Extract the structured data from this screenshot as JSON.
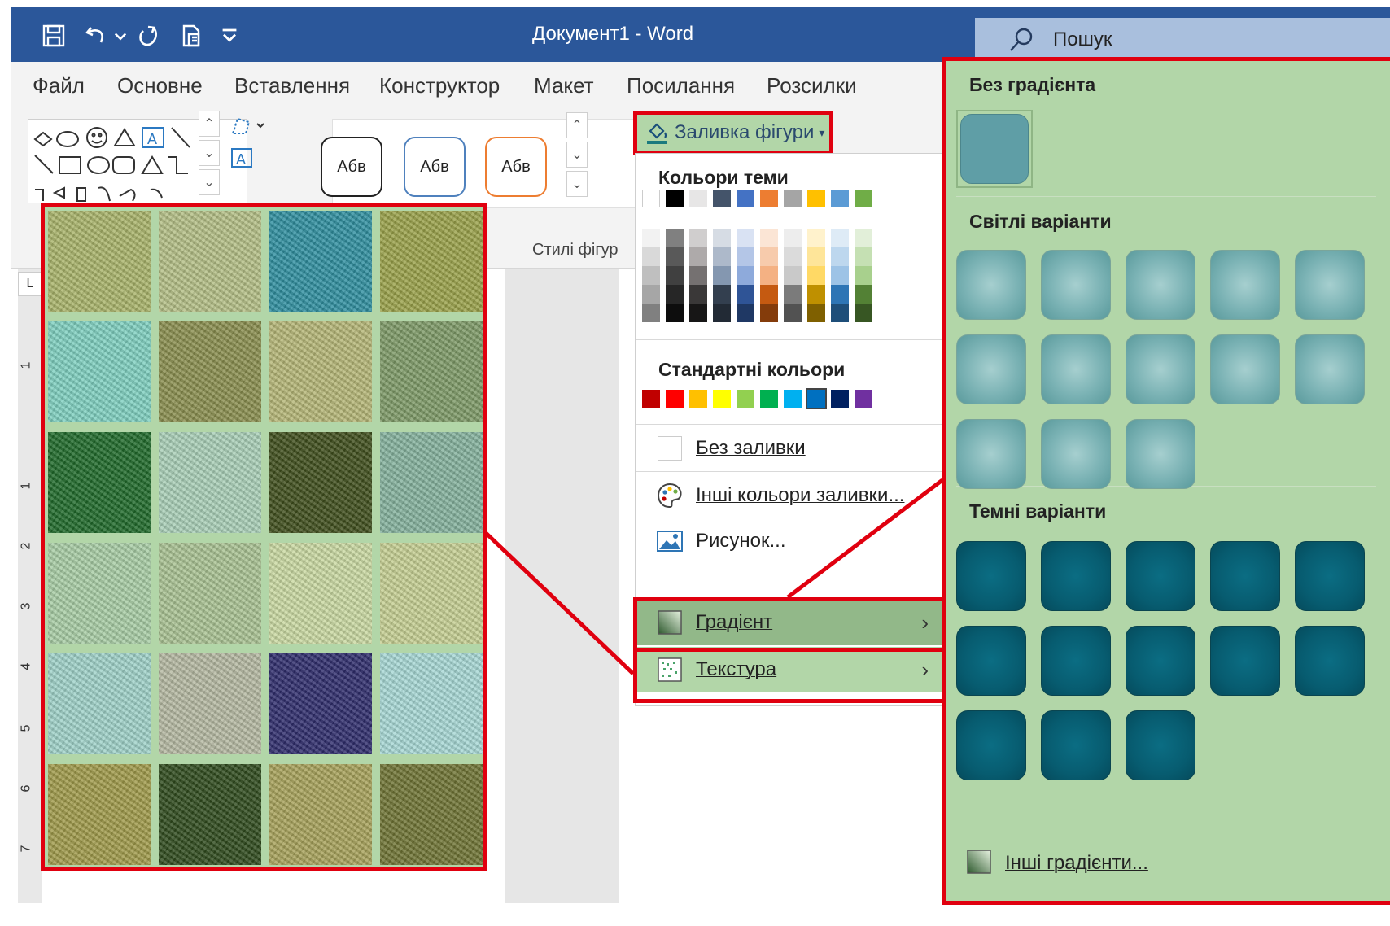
{
  "titlebar": {
    "title": "Документ1  -  Word",
    "search_placeholder": "Пошук",
    "bg_color": "#2b579a",
    "qat_icons": [
      "save-icon",
      "undo-icon",
      "redo-icon",
      "touch-mode-icon",
      "customize-qat-icon"
    ]
  },
  "menu": {
    "items": [
      "Файл",
      "Основне",
      "Вставлення",
      "Конструктор",
      "Макет",
      "Посилання",
      "Розсилки"
    ]
  },
  "ribbon": {
    "shape_style_label": "Абв",
    "styles_group_label": "Стилі фігур",
    "fill_button_label": "Заливка фігури"
  },
  "ruler": {
    "numbers": [
      "1",
      "1",
      "2",
      "3",
      "4",
      "5",
      "6",
      "7"
    ],
    "corner": "L"
  },
  "fill_menu": {
    "theme_colors_heading": "Кольори теми",
    "standard_colors_heading": "Стандартні кольори",
    "theme_colors": [
      "#ffffff",
      "#000000",
      "#e7e6e6",
      "#44546a",
      "#4472c4",
      "#ed7d31",
      "#a5a5a5",
      "#ffc000",
      "#5b9bd5",
      "#70ad47"
    ],
    "theme_shades": [
      [
        "#f2f2f2",
        "#d9d9d9",
        "#bfbfbf",
        "#a6a6a6",
        "#808080"
      ],
      [
        "#808080",
        "#595959",
        "#404040",
        "#262626",
        "#0d0d0d"
      ],
      [
        "#d0cece",
        "#aeaaaa",
        "#757171",
        "#3a3838",
        "#171616"
      ],
      [
        "#d6dce4",
        "#adb9ca",
        "#8497b0",
        "#333f4f",
        "#222a35"
      ],
      [
        "#d9e2f3",
        "#b4c6e7",
        "#8eaadb",
        "#2f5496",
        "#1f3864"
      ],
      [
        "#fbe5d5",
        "#f7cbac",
        "#f4b183",
        "#c55a11",
        "#843c0b"
      ],
      [
        "#ededed",
        "#dbdbdb",
        "#c9c9c9",
        "#7b7b7b",
        "#525252"
      ],
      [
        "#fff2cc",
        "#fee599",
        "#ffd965",
        "#bf9000",
        "#7f6000"
      ],
      [
        "#deebf6",
        "#bdd7ee",
        "#9dc3e6",
        "#2e75b5",
        "#1e4e79"
      ],
      [
        "#e2efd9",
        "#c5e0b3",
        "#a8d08d",
        "#538135",
        "#375623"
      ]
    ],
    "standard_colors": [
      "#c00000",
      "#ff0000",
      "#ffc000",
      "#ffff00",
      "#92d050",
      "#00b050",
      "#00b0f0",
      "#0070c0",
      "#002060",
      "#7030a0"
    ],
    "no_fill": "Без заливки",
    "more_colors": "Інші кольори заливки...",
    "picture": "Рисунок...",
    "gradient": "Градієнт",
    "texture": "Текстура"
  },
  "gradient_panel": {
    "no_gradient_heading": "Без градієнта",
    "light_heading": "Світлі варіанти",
    "dark_heading": "Темні варіанти",
    "more_gradients": "Інші градієнти...",
    "no_gradient_color": "#5f9ea6"
  },
  "texture_panel": {
    "textures": [
      [
        "#a9b46a",
        "#b4bf86",
        "#2f8fa0",
        "#9aa24a"
      ],
      [
        "#7fd0c0",
        "#8a8e4e",
        "#b5b676",
        "#7e9a67"
      ],
      [
        "#1f6a2a",
        "#a9cfb7",
        "#3f4e1c",
        "#84b29d"
      ],
      [
        "#a8cda5",
        "#a9c293",
        "#cad9a2",
        "#c6cf93"
      ],
      [
        "#9fd2c9",
        "#b5b9a2",
        "#2f2d6d",
        "#a7d8d5"
      ],
      [
        "#a09a4a",
        "#2f4b1d",
        "#a7a25a",
        "#6f7434"
      ]
    ]
  }
}
